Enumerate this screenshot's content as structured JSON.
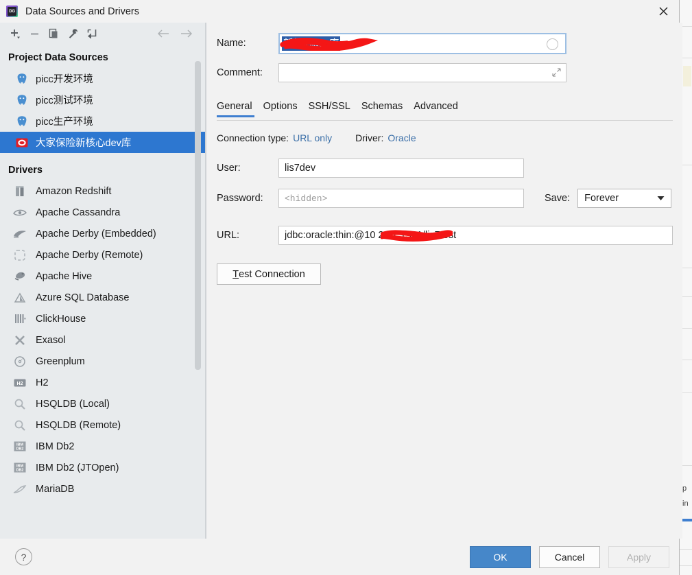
{
  "window": {
    "title": "Data Sources and Drivers",
    "logo_icon": "datagrip-logo-icon",
    "logo_text": "DG",
    "close_icon": "close-icon"
  },
  "left_panel": {
    "toolbar": [
      {
        "name": "add-button",
        "icon": "plus-icon"
      },
      {
        "name": "remove-button",
        "icon": "minus-icon"
      },
      {
        "name": "duplicate-button",
        "icon": "copy-icon"
      },
      {
        "name": "driver-properties-button",
        "icon": "wrench-icon"
      },
      {
        "name": "move-to-button",
        "icon": "move-down-left-icon"
      }
    ],
    "nav_back_icon": "arrow-left-icon",
    "nav_forward_icon": "arrow-right-icon",
    "project_header": "Project Data Sources",
    "data_sources": [
      {
        "label": "picc开发环境",
        "icon": "postgresql-icon",
        "selected": false
      },
      {
        "label": "picc测试环境",
        "icon": "postgresql-icon",
        "selected": false
      },
      {
        "label": "picc生产环境",
        "icon": "postgresql-icon",
        "selected": false
      },
      {
        "label": "大家保险新核心dev库",
        "icon": "oracle-icon",
        "selected": true
      }
    ],
    "drivers_header": "Drivers",
    "drivers": [
      {
        "label": "Amazon Redshift",
        "icon": "redshift-icon"
      },
      {
        "label": "Apache Cassandra",
        "icon": "cassandra-icon"
      },
      {
        "label": "Apache Derby (Embedded)",
        "icon": "derby-icon"
      },
      {
        "label": "Apache Derby (Remote)",
        "icon": "derby-remote-icon"
      },
      {
        "label": "Apache Hive",
        "icon": "hive-icon"
      },
      {
        "label": "Azure SQL Database",
        "icon": "azure-icon"
      },
      {
        "label": "ClickHouse",
        "icon": "clickhouse-icon"
      },
      {
        "label": "Exasol",
        "icon": "exasol-icon"
      },
      {
        "label": "Greenplum",
        "icon": "greenplum-icon"
      },
      {
        "label": "H2",
        "icon": "h2-icon"
      },
      {
        "label": "HSQLDB (Local)",
        "icon": "hsqldb-icon"
      },
      {
        "label": "HSQLDB (Remote)",
        "icon": "hsqldb-icon"
      },
      {
        "label": "IBM Db2",
        "icon": "db2-icon"
      },
      {
        "label": "IBM Db2 (JTOpen)",
        "icon": "db2-icon"
      },
      {
        "label": "MariaDB",
        "icon": "mariadb-icon"
      }
    ]
  },
  "right_panel": {
    "name_label": "Name:",
    "name_value": "新核心dev库",
    "name_selected": true,
    "name_redacted": true,
    "color_dot_icon": "color-swatch-icon",
    "comment_label": "Comment:",
    "comment_value": "",
    "comment_expand_icon": "expand-icon",
    "tabs": [
      {
        "label": "General",
        "active": true
      },
      {
        "label": "Options",
        "active": false
      },
      {
        "label": "SSH/SSL",
        "active": false
      },
      {
        "label": "Schemas",
        "active": false
      },
      {
        "label": "Advanced",
        "active": false
      }
    ],
    "connection_type_label": "Connection type:",
    "connection_type_value": "URL only",
    "driver_label": "Driver:",
    "driver_value": "Oracle",
    "user_label": "User:",
    "user_value": "lis7dev",
    "password_label": "Password:",
    "password_placeholder": "<hidden>",
    "save_label": "Save:",
    "save_value": "Forever",
    "save_chevron_icon": "chevron-down-icon",
    "url_label": "URL:",
    "url_value": "jdbc:oracle:thin:@10       2.97.1521/lis7test",
    "url_redacted": true,
    "test_connection_mnemonic": "T",
    "test_connection_rest": "est Connection"
  },
  "footer": {
    "help_icon": "help-icon",
    "help_label": "?",
    "ok_label": "OK",
    "cancel_label": "Cancel",
    "apply_label": "Apply",
    "apply_enabled": false
  },
  "background": {
    "tab_fragment_top": "p",
    "tab_fragment_bottom": "in"
  },
  "colors": {
    "accent_blue": "#3f7fd0",
    "selection_blue": "#2d77d0",
    "ok_button": "#4687c9",
    "link_blue": "#3b6fa8",
    "redaction_red": "#f41616",
    "panel_bg": "#f2f2f2",
    "sidebar_bg": "#e8ebed",
    "oracle_red": "#e02027",
    "postgres_blue": "#4a8fd0"
  }
}
